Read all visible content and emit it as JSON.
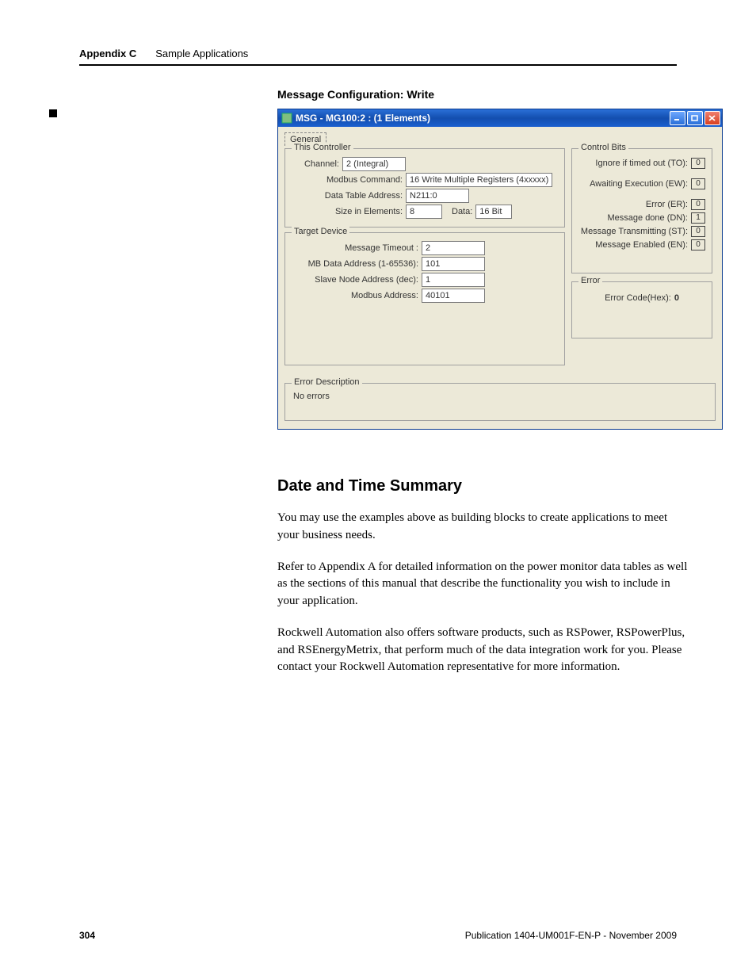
{
  "header": {
    "appendix": "Appendix C",
    "section": "Sample Applications"
  },
  "caption": "Message Configuration: Write",
  "window": {
    "title": "MSG - MG100:2 : (1 Elements)",
    "tab": "General",
    "this_controller": {
      "legend": "This Controller",
      "channel_label": "Channel:",
      "channel_value": "2 (Integral)",
      "modbus_cmd_label": "Modbus Command:",
      "modbus_cmd_value": "16 Write Multiple Registers (4xxxxx)",
      "dta_label": "Data Table Address:",
      "dta_value": "N211:0",
      "size_label": "Size in Elements:",
      "size_value": "8",
      "data_label": "Data:",
      "data_value": "16 Bit"
    },
    "target_device": {
      "legend": "Target Device",
      "timeout_label": "Message Timeout :",
      "timeout_value": "2",
      "mbaddr_label": "MB Data Address (1-65536):",
      "mbaddr_value": "101",
      "slave_label": "Slave Node Address (dec):",
      "slave_value": "1",
      "modaddr_label": "Modbus Address:",
      "modaddr_value": "40101"
    },
    "control_bits": {
      "legend": "Control Bits",
      "to_label": "Ignore if timed out (TO):",
      "to_value": "0",
      "ew_label": "Awaiting Execution (EW):",
      "ew_value": "0",
      "er_label": "Error (ER):",
      "er_value": "0",
      "dn_label": "Message done (DN):",
      "dn_value": "1",
      "st_label": "Message Transmitting (ST):",
      "st_value": "0",
      "en_label": "Message Enabled (EN):",
      "en_value": "0"
    },
    "error_group": {
      "legend": "Error",
      "code_label": "Error Code(Hex):",
      "code_value": "0"
    },
    "error_desc": {
      "legend": "Error Description",
      "text": "No errors"
    }
  },
  "heading": "Date and Time Summary",
  "p1": "You may use the examples above as building blocks to create applications to meet your business needs.",
  "p2": "Refer to Appendix A for detailed information on the power monitor data tables as well as the sections of this manual that describe the functionality you wish to include in your application.",
  "p3": "Rockwell Automation also offers software products, such as RSPower, RSPowerPlus, and RSEnergyMetrix, that perform much of the data integration work for you. Please contact your Rockwell Automation representative for more information.",
  "footer": {
    "page": "304",
    "pub": "Publication 1404-UM001F-EN-P - November 2009"
  }
}
